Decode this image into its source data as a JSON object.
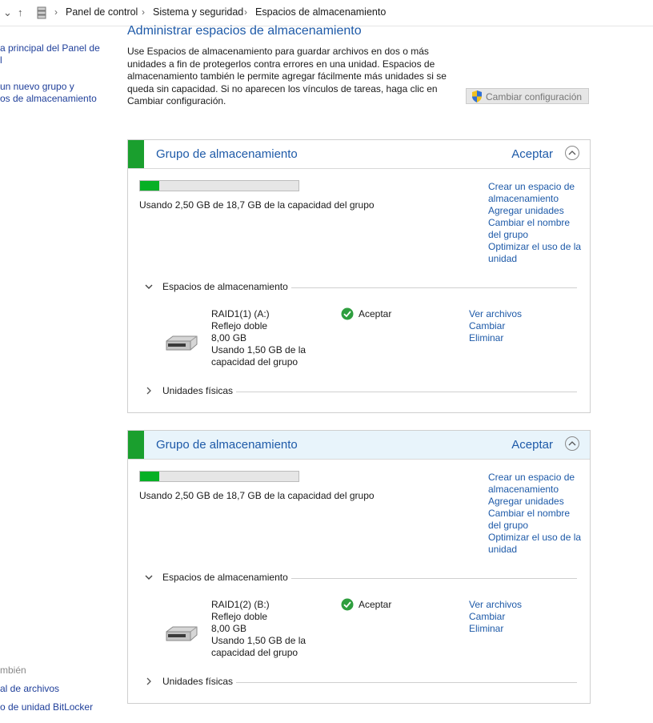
{
  "breadcrumb": [
    "Panel de control",
    "Sistema y seguridad",
    "Espacios de almacenamiento"
  ],
  "left_pane": {
    "links": [
      "a principal del Panel de",
      "l",
      "un nuevo grupo y",
      "os de almacenamiento"
    ],
    "see_also_heading": "mbién",
    "see_also": [
      "al de archivos",
      "o de unidad BitLocker"
    ]
  },
  "main": {
    "title": "Administrar espacios de almacenamiento",
    "intro": "Use Espacios de almacenamiento para guardar archivos en dos o más unidades a fin de protegerlos contra errores en una unidad. Espacios de almacenamiento también le permite agregar fácilmente más unidades si se queda sin capacidad. Si no aparecen los vínculos de tareas, haga clic en Cambiar configuración.",
    "change_settings": "Cambiar configuración"
  },
  "pools": [
    {
      "title": "Grupo de almacenamiento",
      "status": "Aceptar",
      "usage_fraction": 0.12,
      "usage_text": "Usando 2,50 GB de 18,7 GB de la capacidad del grupo",
      "tasks": [
        "Crear un espacio de",
        "almacenamiento",
        "Agregar unidades",
        "Cambiar el nombre",
        "del grupo",
        "Optimizar el uso de la",
        "unidad"
      ],
      "spaces_label": "Espacios de almacenamiento",
      "space": {
        "name": "RAID1(1) (A:)",
        "resiliency": "Reflejo doble",
        "size": "8,00 GB",
        "usage_1": "Usando 1,50 GB de la",
        "usage_2": "capacidad del grupo",
        "status": "Aceptar",
        "actions": [
          "Ver archivos",
          "Cambiar",
          "Eliminar"
        ]
      },
      "physical_label": "Unidades físicas"
    },
    {
      "title": "Grupo de almacenamiento",
      "status": "Aceptar",
      "usage_fraction": 0.12,
      "usage_text": "Usando 2,50 GB de 18,7 GB de la capacidad del grupo",
      "tasks": [
        "Crear un espacio de",
        "almacenamiento",
        "Agregar unidades",
        "Cambiar el nombre",
        "del grupo",
        "Optimizar el uso de la",
        "unidad"
      ],
      "spaces_label": "Espacios de almacenamiento",
      "space": {
        "name": "RAID1(2) (B:)",
        "resiliency": "Reflejo doble",
        "size": "8,00 GB",
        "usage_1": "Usando 1,50 GB de la",
        "usage_2": "capacidad del grupo",
        "status": "Aceptar",
        "actions": [
          "Ver archivos",
          "Cambiar",
          "Eliminar"
        ]
      },
      "physical_label": "Unidades físicas"
    }
  ],
  "colors": {
    "accent": "#1e5aa8",
    "pool_stripe": "#1a9f2e",
    "usage_fill": "#06b025",
    "selected_header": "#e8f4fb"
  }
}
